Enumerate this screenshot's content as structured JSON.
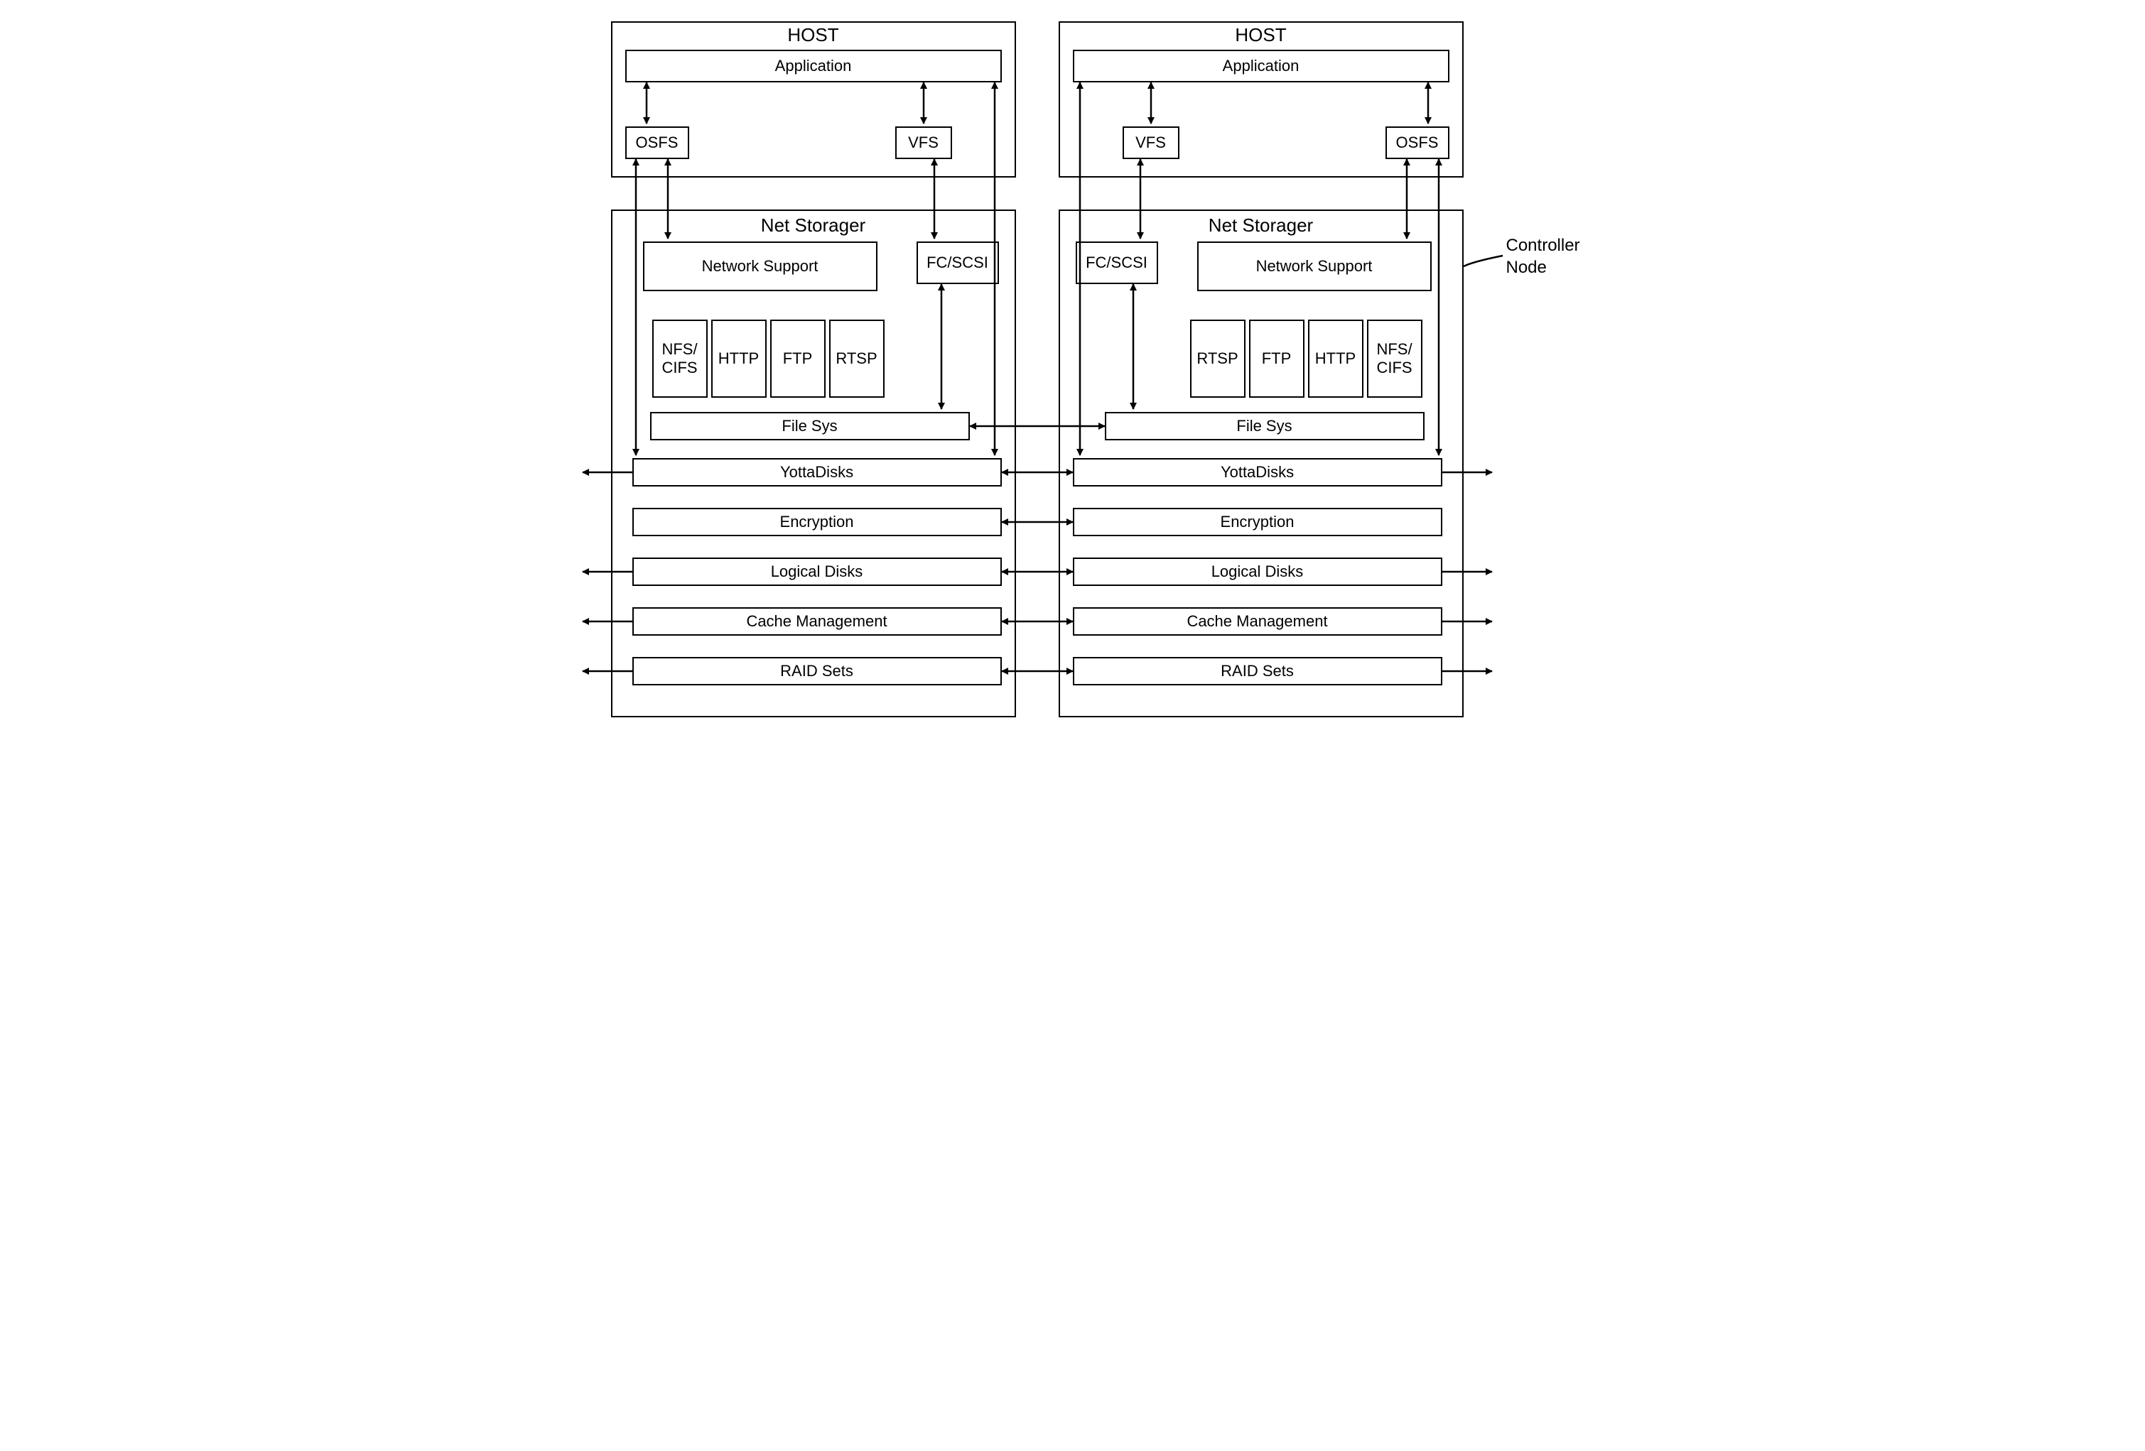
{
  "annotation": {
    "controller_node": "Controller Node"
  },
  "left": {
    "host": {
      "title": "HOST",
      "application": "Application",
      "osfs": "OSFS",
      "vfs": "VFS"
    },
    "storager": {
      "title": "Net Storager",
      "network_support": "Network Support",
      "fc_scsi": "FC/SCSI",
      "protocols": {
        "p0": "NFS/\nCIFS",
        "p1": "HTTP",
        "p2": "FTP",
        "p3": "RTSP"
      },
      "filesys": "File Sys",
      "layers": {
        "l0": "YottaDisks",
        "l1": "Encryption",
        "l2": "Logical Disks",
        "l3": "Cache Management",
        "l4": "RAID Sets"
      }
    }
  },
  "right": {
    "host": {
      "title": "HOST",
      "application": "Application",
      "vfs": "VFS",
      "osfs": "OSFS"
    },
    "storager": {
      "title": "Net Storager",
      "fc_scsi": "FC/SCSI",
      "network_support": "Network Support",
      "protocols": {
        "p0": "RTSP",
        "p1": "FTP",
        "p2": "HTTP",
        "p3": "NFS/\nCIFS"
      },
      "filesys": "File Sys",
      "layers": {
        "l0": "YottaDisks",
        "l1": "Encryption",
        "l2": "Logical Disks",
        "l3": "Cache Management",
        "l4": "RAID Sets"
      }
    }
  }
}
